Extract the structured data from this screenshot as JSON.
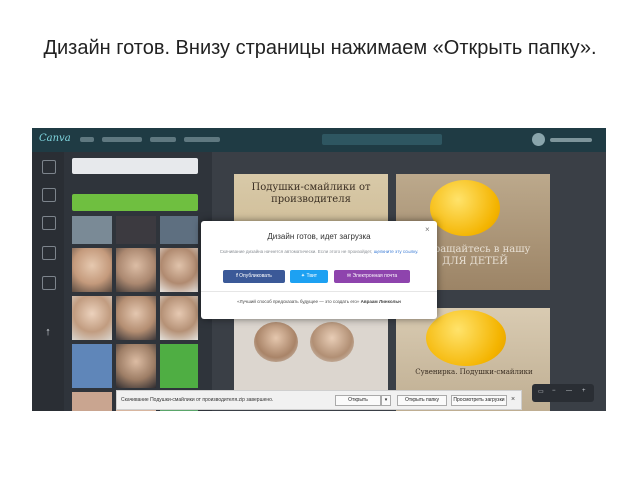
{
  "slide": {
    "title": "Дизайн готов. Внизу страницы нажимаем «Открыть папку»."
  },
  "app": {
    "logo": "Canva",
    "accent_color": "#1f3b44",
    "panel_color": "#2f343b",
    "upload_icon": "arrow-up-icon"
  },
  "canvas": {
    "page1_text": "Подушки-смайлики от производителя",
    "page2_text": "Обращайтесь в нашу ДЛЯ ДЕТЕЙ",
    "page3_text": "Сувенирка. Подушки-смайлики"
  },
  "modal": {
    "title": "Дизайн готов, идет загрузка",
    "close": "×",
    "subtitle": "Скачивание дизайна начнется автоматически. Если этого не произойдет,",
    "subtitle_link": "щелкните эту ссылку.",
    "buttons": {
      "publish": "Опубликовать",
      "tweet": "Твит",
      "email": "Электронная почта"
    },
    "button_colors": {
      "publish": "#3b5998",
      "tweet": "#1da1f2",
      "email": "#8e44ad"
    },
    "quote": "«Лучший способ предсказать будущее — это создать его»",
    "quote_author": "Авраам Линкольн"
  },
  "download_bar": {
    "message": "Скачивание Подушки-смайлики от производителя.zip завершено.",
    "open": "Открыть",
    "open_folder": "Открыть папку",
    "view_downloads": "Просмотреть загрузки",
    "close": "×"
  },
  "zoom": {
    "value": "—"
  }
}
